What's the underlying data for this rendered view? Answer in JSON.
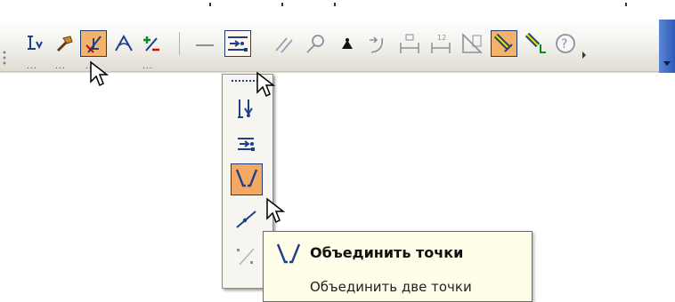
{
  "window": {
    "title": ""
  },
  "toolbar": {
    "buttons": [
      {
        "name": "edit-point-icon",
        "state": "normal"
      },
      {
        "name": "hammer-icon",
        "state": "normal"
      },
      {
        "name": "perpendicular-constraint-icon",
        "state": "active"
      },
      {
        "name": "angle-constraint-icon",
        "state": "normal"
      },
      {
        "name": "add-remove-constraint-icon",
        "state": "normal"
      },
      {
        "name": "horizontal-line-icon",
        "state": "normal"
      },
      {
        "name": "merge-points-group-icon",
        "state": "selected"
      },
      {
        "name": "parallel-lines-icon",
        "state": "normal"
      },
      {
        "name": "tangent-circle-icon",
        "state": "normal"
      },
      {
        "name": "fix-point-icon",
        "state": "normal"
      },
      {
        "name": "dimension-arrow-icon",
        "state": "normal"
      },
      {
        "name": "horizontal-dimension-icon",
        "state": "normal"
      },
      {
        "name": "numbered-dimension-icon",
        "state": "normal"
      },
      {
        "name": "triangle-icon",
        "state": "normal"
      },
      {
        "name": "pencil-active-icon",
        "state": "active"
      },
      {
        "name": "pencil-point-icon",
        "state": "normal"
      },
      {
        "name": "help-icon",
        "state": "normal"
      }
    ],
    "tb_number_label": "12"
  },
  "flyout": {
    "items": [
      {
        "name": "point-on-curve-icon",
        "state": "normal"
      },
      {
        "name": "collinear-points-icon",
        "state": "normal"
      },
      {
        "name": "merge-points-icon",
        "state": "active"
      },
      {
        "name": "point-on-line-icon",
        "state": "normal"
      },
      {
        "name": "midpoint-icon",
        "state": "normal"
      }
    ]
  },
  "tooltip": {
    "title": "Объединить точки",
    "description": "Объединить две точки"
  },
  "colors": {
    "active_bg": "#f4b36a",
    "border_blue": "#1f3c7a",
    "icon_blue": "#1e3f8a",
    "tooltip_bg": "#fffee8"
  }
}
